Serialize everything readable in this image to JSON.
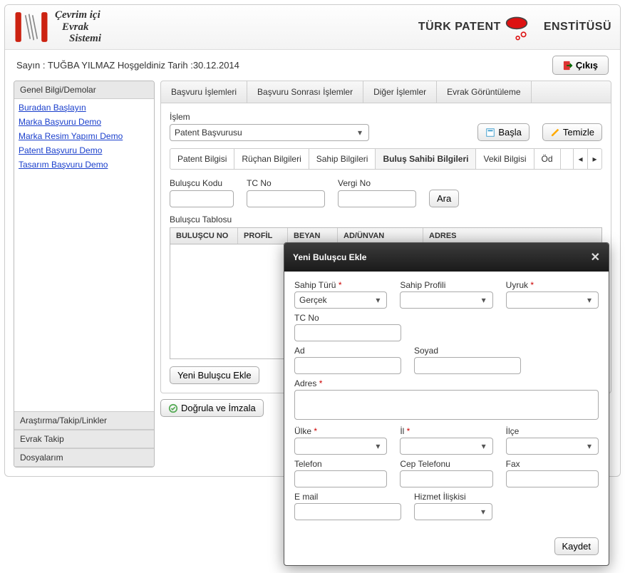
{
  "header": {
    "app_title_l1": "Çevrim içi",
    "app_title_l2": "Evrak",
    "app_title_l3": "Sistemi",
    "brand_right_a": "TÜRK PATENT",
    "brand_right_b": "ENSTİTÜSÜ"
  },
  "subheader": {
    "welcome": "Sayın : TUĞBA YILMAZ Hoşgeldiniz Tarih :30.12.2014",
    "logout": "Çıkış"
  },
  "sidebar": {
    "sec1": "Genel Bilgi/Demolar",
    "links": [
      "Buradan Başlayın",
      "Marka Başvuru Demo",
      "Marka Resim Yapımı Demo",
      "Patent Başvuru Demo",
      "Tasarım Başvuru Demo"
    ],
    "sec2": "Araştırma/Takip/Linkler",
    "sec3": "Evrak Takip",
    "sec4": "Dosyalarım"
  },
  "toptabs": {
    "t1": "Başvuru İşlemleri",
    "t2": "Başvuru Sonrası İşlemler",
    "t3": "Diğer İşlemler",
    "t4": "Evrak Görüntüleme"
  },
  "form": {
    "islem_label": "İşlem",
    "islem_value": "Patent Başvurusu",
    "basla": "Başla",
    "temizle": "Temizle"
  },
  "innertabs": {
    "t1": "Patent Bilgisi",
    "t2": "Rüçhan Bilgileri",
    "t3": "Sahip Bilgileri",
    "t4": "Buluş Sahibi Bilgileri",
    "t5": "Vekil Bilgisi",
    "t6": "Öd"
  },
  "search": {
    "buluscu_kodu": "Buluşcu Kodu",
    "tc_no": "TC No",
    "vergi_no": "Vergi No",
    "ara": "Ara"
  },
  "table": {
    "title": "Buluşcu Tablosu",
    "h1": "BULUŞCU NO",
    "h2": "PROFİL",
    "h3": "BEYAN",
    "h4": "AD/ÜNVAN",
    "h5": "ADRES"
  },
  "actions": {
    "yeni_buluscu": "Yeni Buluşcu Ekle",
    "dogrula": "Doğrula ve İmzala"
  },
  "dialog": {
    "title": "Yeni Buluşcu Ekle",
    "sahip_turu": "Sahip Türü",
    "sahip_turu_val": "Gerçek",
    "sahip_profili": "Sahip Profili",
    "uyruk": "Uyruk",
    "tc_no": "TC No",
    "ad": "Ad",
    "soyad": "Soyad",
    "adres": "Adres",
    "ulke": "Ülke",
    "il": "İl",
    "ilce": "İlçe",
    "telefon": "Telefon",
    "cep": "Cep Telefonu",
    "fax": "Fax",
    "email": "E mail",
    "hizmet": "Hizmet İlişkisi",
    "kaydet": "Kaydet"
  }
}
